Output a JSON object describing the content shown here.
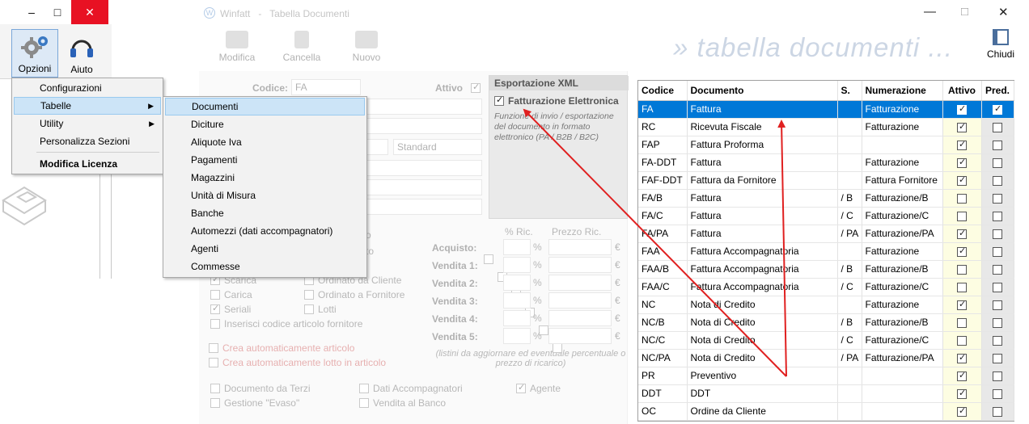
{
  "back_window": {
    "opzioni_label": "Opzioni",
    "aiuto_label": "Aiuto",
    "minimize_symbol": "–",
    "maximize_symbol": "□",
    "close_symbol": "✕"
  },
  "main_window": {
    "app_name": "Winfatt",
    "separator": "-",
    "window_title": "Tabella Documenti",
    "minimize_symbol": "—",
    "maximize_symbol": "□",
    "close_symbol": "✕",
    "toolbar": {
      "modifica": "Modifica",
      "cancella": "Cancella",
      "nuovo": "Nuovo",
      "chiudi": "Chiudi"
    },
    "banner": "» tabella documenti ...",
    "form": {
      "codice_label": "Codice:",
      "codice_value": "FA",
      "attivo_label": "Attivo",
      "numerazione_value": "Fatturazione",
      "standard_value": "Standard",
      "ric_header": "% Ric.",
      "prezzo_header": "Prezzo Ric.",
      "acquisto_label": "Acquisto:",
      "vendita1": "Vendita 1:",
      "vendita2": "Vendita 2:",
      "vendita3": "Vendita 3:",
      "vendita4": "Vendita 4:",
      "vendita5": "Vendita 5:",
      "pct": "%",
      "eur": "€",
      "listini_note": "(listini da aggiornare ed eventuale percentuale o prezzo di ricarico)",
      "scarica": "Scarica",
      "carica": "Carica",
      "seriali": "Seriali",
      "ordinato_cliente": "Ordinato da Cliente",
      "ordinato_fornitore": "Ordinato a Fornitore",
      "lotti": "Lotti",
      "inserisci_codice": "Inserisci codice articolo fornitore",
      "crea_articolo": "Crea automaticamente articolo",
      "crea_lotto": "Crea automaticamente lotto in articolo",
      "documento_terzi": "Documento da Terzi",
      "gestione_evaso": "Gestione \"Evaso\"",
      "dati_accompagnatori": "Dati Accompagnatori",
      "vendita_banco": "Vendita al Banco",
      "agente": "Agente",
      "partial_o1": "o",
      "partial_o2": "to"
    },
    "xml": {
      "header": "Esportazione XML",
      "fatturazione_label": "Fatturazione Elettronica",
      "description": "Funzione di invio / esportazione del documento in formato elettronico (PA / B2B / B2C)"
    }
  },
  "grid": {
    "columns": [
      "Codice",
      "Documento",
      "S.",
      "Numerazione",
      "Attivo",
      "Pred."
    ],
    "rows": [
      {
        "codice": "FA",
        "documento": "Fattura",
        "s": "",
        "numerazione": "Fatturazione",
        "attivo": true,
        "pred": true,
        "selected": true
      },
      {
        "codice": "RC",
        "documento": "Ricevuta Fiscale",
        "s": "",
        "numerazione": "Fatturazione",
        "attivo": true,
        "pred": false
      },
      {
        "codice": "FAP",
        "documento": "Fattura Proforma",
        "s": "",
        "numerazione": "",
        "attivo": true,
        "pred": false
      },
      {
        "codice": "FA-DDT",
        "documento": "Fattura",
        "s": "",
        "numerazione": "Fatturazione",
        "attivo": true,
        "pred": false
      },
      {
        "codice": "FAF-DDT",
        "documento": "Fattura da Fornitore",
        "s": "",
        "numerazione": "Fattura Fornitore",
        "attivo": true,
        "pred": false
      },
      {
        "codice": "FA/B",
        "documento": "Fattura",
        "s": "/ B",
        "numerazione": "Fatturazione/B",
        "attivo": false,
        "pred": false
      },
      {
        "codice": "FA/C",
        "documento": "Fattura",
        "s": "/ C",
        "numerazione": "Fatturazione/C",
        "attivo": false,
        "pred": false
      },
      {
        "codice": "FA/PA",
        "documento": "Fattura",
        "s": "/ PA",
        "numerazione": "Fatturazione/PA",
        "attivo": true,
        "pred": false
      },
      {
        "codice": "FAA",
        "documento": "Fattura Accompagnatoria",
        "s": "",
        "numerazione": "Fatturazione",
        "attivo": true,
        "pred": false
      },
      {
        "codice": "FAA/B",
        "documento": "Fattura Accompagnatoria",
        "s": "/ B",
        "numerazione": "Fatturazione/B",
        "attivo": false,
        "pred": false
      },
      {
        "codice": "FAA/C",
        "documento": "Fattura Accompagnatoria",
        "s": "/ C",
        "numerazione": "Fatturazione/C",
        "attivo": false,
        "pred": false
      },
      {
        "codice": "NC",
        "documento": "Nota di Credito",
        "s": "",
        "numerazione": "Fatturazione",
        "attivo": true,
        "pred": false
      },
      {
        "codice": "NC/B",
        "documento": "Nota di Credito",
        "s": "/ B",
        "numerazione": "Fatturazione/B",
        "attivo": false,
        "pred": false
      },
      {
        "codice": "NC/C",
        "documento": "Nota di Credito",
        "s": "/ C",
        "numerazione": "Fatturazione/C",
        "attivo": false,
        "pred": false
      },
      {
        "codice": "NC/PA",
        "documento": "Nota di Credito",
        "s": "/ PA",
        "numerazione": "Fatturazione/PA",
        "attivo": true,
        "pred": false
      },
      {
        "codice": "PR",
        "documento": "Preventivo",
        "s": "",
        "numerazione": "",
        "attivo": true,
        "pred": false
      },
      {
        "codice": "DDT",
        "documento": "DDT",
        "s": "",
        "numerazione": "",
        "attivo": true,
        "pred": false
      },
      {
        "codice": "OC",
        "documento": "Ordine da Cliente",
        "s": "",
        "numerazione": "",
        "attivo": true,
        "pred": false
      }
    ]
  },
  "menu_opzioni": {
    "configurazioni": "Configurazioni",
    "tabelle": "Tabelle",
    "utility": "Utility",
    "personalizza": "Personalizza Sezioni",
    "modifica_licenza": "Modifica Licenza",
    "submenu_arrow": "▶"
  },
  "menu_tabelle": {
    "items": [
      "Documenti",
      "Diciture",
      "Aliquote Iva",
      "Pagamenti",
      "Magazzini",
      "Unità di Misura",
      "Banche",
      "Automezzi (dati accompagnatori)",
      "Agenti",
      "Commesse"
    ]
  },
  "colors": {
    "selection": "#0078d7",
    "annotation_arrow": "#e02020",
    "menu_highlight": "#cce4f7",
    "close_button": "#e81123"
  }
}
